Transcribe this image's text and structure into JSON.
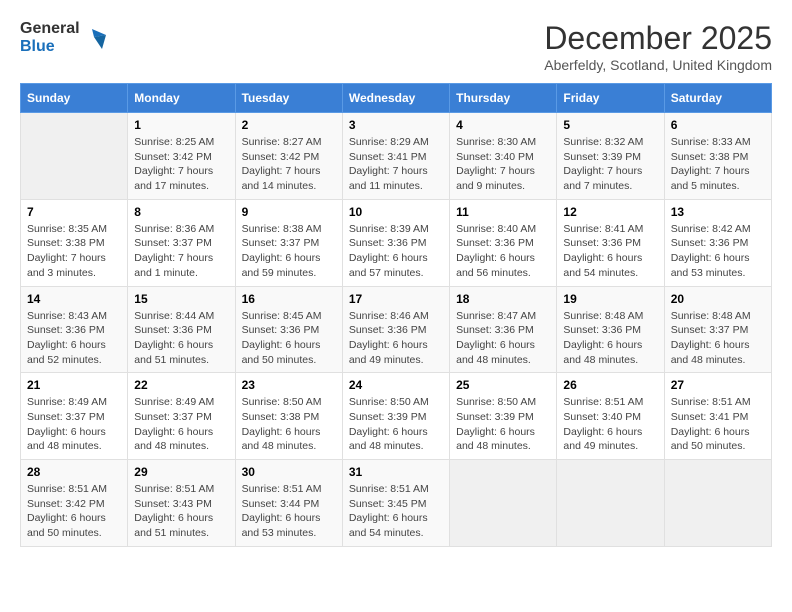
{
  "logo": {
    "general": "General",
    "blue": "Blue"
  },
  "title": "December 2025",
  "subtitle": "Aberfeldy, Scotland, United Kingdom",
  "days_of_week": [
    "Sunday",
    "Monday",
    "Tuesday",
    "Wednesday",
    "Thursday",
    "Friday",
    "Saturday"
  ],
  "weeks": [
    [
      {
        "day": "",
        "sunrise": "",
        "sunset": "",
        "daylight": ""
      },
      {
        "day": "1",
        "sunrise": "Sunrise: 8:25 AM",
        "sunset": "Sunset: 3:42 PM",
        "daylight": "Daylight: 7 hours and 17 minutes."
      },
      {
        "day": "2",
        "sunrise": "Sunrise: 8:27 AM",
        "sunset": "Sunset: 3:42 PM",
        "daylight": "Daylight: 7 hours and 14 minutes."
      },
      {
        "day": "3",
        "sunrise": "Sunrise: 8:29 AM",
        "sunset": "Sunset: 3:41 PM",
        "daylight": "Daylight: 7 hours and 11 minutes."
      },
      {
        "day": "4",
        "sunrise": "Sunrise: 8:30 AM",
        "sunset": "Sunset: 3:40 PM",
        "daylight": "Daylight: 7 hours and 9 minutes."
      },
      {
        "day": "5",
        "sunrise": "Sunrise: 8:32 AM",
        "sunset": "Sunset: 3:39 PM",
        "daylight": "Daylight: 7 hours and 7 minutes."
      },
      {
        "day": "6",
        "sunrise": "Sunrise: 8:33 AM",
        "sunset": "Sunset: 3:38 PM",
        "daylight": "Daylight: 7 hours and 5 minutes."
      }
    ],
    [
      {
        "day": "7",
        "sunrise": "Sunrise: 8:35 AM",
        "sunset": "Sunset: 3:38 PM",
        "daylight": "Daylight: 7 hours and 3 minutes."
      },
      {
        "day": "8",
        "sunrise": "Sunrise: 8:36 AM",
        "sunset": "Sunset: 3:37 PM",
        "daylight": "Daylight: 7 hours and 1 minute."
      },
      {
        "day": "9",
        "sunrise": "Sunrise: 8:38 AM",
        "sunset": "Sunset: 3:37 PM",
        "daylight": "Daylight: 6 hours and 59 minutes."
      },
      {
        "day": "10",
        "sunrise": "Sunrise: 8:39 AM",
        "sunset": "Sunset: 3:36 PM",
        "daylight": "Daylight: 6 hours and 57 minutes."
      },
      {
        "day": "11",
        "sunrise": "Sunrise: 8:40 AM",
        "sunset": "Sunset: 3:36 PM",
        "daylight": "Daylight: 6 hours and 56 minutes."
      },
      {
        "day": "12",
        "sunrise": "Sunrise: 8:41 AM",
        "sunset": "Sunset: 3:36 PM",
        "daylight": "Daylight: 6 hours and 54 minutes."
      },
      {
        "day": "13",
        "sunrise": "Sunrise: 8:42 AM",
        "sunset": "Sunset: 3:36 PM",
        "daylight": "Daylight: 6 hours and 53 minutes."
      }
    ],
    [
      {
        "day": "14",
        "sunrise": "Sunrise: 8:43 AM",
        "sunset": "Sunset: 3:36 PM",
        "daylight": "Daylight: 6 hours and 52 minutes."
      },
      {
        "day": "15",
        "sunrise": "Sunrise: 8:44 AM",
        "sunset": "Sunset: 3:36 PM",
        "daylight": "Daylight: 6 hours and 51 minutes."
      },
      {
        "day": "16",
        "sunrise": "Sunrise: 8:45 AM",
        "sunset": "Sunset: 3:36 PM",
        "daylight": "Daylight: 6 hours and 50 minutes."
      },
      {
        "day": "17",
        "sunrise": "Sunrise: 8:46 AM",
        "sunset": "Sunset: 3:36 PM",
        "daylight": "Daylight: 6 hours and 49 minutes."
      },
      {
        "day": "18",
        "sunrise": "Sunrise: 8:47 AM",
        "sunset": "Sunset: 3:36 PM",
        "daylight": "Daylight: 6 hours and 48 minutes."
      },
      {
        "day": "19",
        "sunrise": "Sunrise: 8:48 AM",
        "sunset": "Sunset: 3:36 PM",
        "daylight": "Daylight: 6 hours and 48 minutes."
      },
      {
        "day": "20",
        "sunrise": "Sunrise: 8:48 AM",
        "sunset": "Sunset: 3:37 PM",
        "daylight": "Daylight: 6 hours and 48 minutes."
      }
    ],
    [
      {
        "day": "21",
        "sunrise": "Sunrise: 8:49 AM",
        "sunset": "Sunset: 3:37 PM",
        "daylight": "Daylight: 6 hours and 48 minutes."
      },
      {
        "day": "22",
        "sunrise": "Sunrise: 8:49 AM",
        "sunset": "Sunset: 3:37 PM",
        "daylight": "Daylight: 6 hours and 48 minutes."
      },
      {
        "day": "23",
        "sunrise": "Sunrise: 8:50 AM",
        "sunset": "Sunset: 3:38 PM",
        "daylight": "Daylight: 6 hours and 48 minutes."
      },
      {
        "day": "24",
        "sunrise": "Sunrise: 8:50 AM",
        "sunset": "Sunset: 3:39 PM",
        "daylight": "Daylight: 6 hours and 48 minutes."
      },
      {
        "day": "25",
        "sunrise": "Sunrise: 8:50 AM",
        "sunset": "Sunset: 3:39 PM",
        "daylight": "Daylight: 6 hours and 48 minutes."
      },
      {
        "day": "26",
        "sunrise": "Sunrise: 8:51 AM",
        "sunset": "Sunset: 3:40 PM",
        "daylight": "Daylight: 6 hours and 49 minutes."
      },
      {
        "day": "27",
        "sunrise": "Sunrise: 8:51 AM",
        "sunset": "Sunset: 3:41 PM",
        "daylight": "Daylight: 6 hours and 50 minutes."
      }
    ],
    [
      {
        "day": "28",
        "sunrise": "Sunrise: 8:51 AM",
        "sunset": "Sunset: 3:42 PM",
        "daylight": "Daylight: 6 hours and 50 minutes."
      },
      {
        "day": "29",
        "sunrise": "Sunrise: 8:51 AM",
        "sunset": "Sunset: 3:43 PM",
        "daylight": "Daylight: 6 hours and 51 minutes."
      },
      {
        "day": "30",
        "sunrise": "Sunrise: 8:51 AM",
        "sunset": "Sunset: 3:44 PM",
        "daylight": "Daylight: 6 hours and 53 minutes."
      },
      {
        "day": "31",
        "sunrise": "Sunrise: 8:51 AM",
        "sunset": "Sunset: 3:45 PM",
        "daylight": "Daylight: 6 hours and 54 minutes."
      },
      {
        "day": "",
        "sunrise": "",
        "sunset": "",
        "daylight": ""
      },
      {
        "day": "",
        "sunrise": "",
        "sunset": "",
        "daylight": ""
      },
      {
        "day": "",
        "sunrise": "",
        "sunset": "",
        "daylight": ""
      }
    ]
  ]
}
